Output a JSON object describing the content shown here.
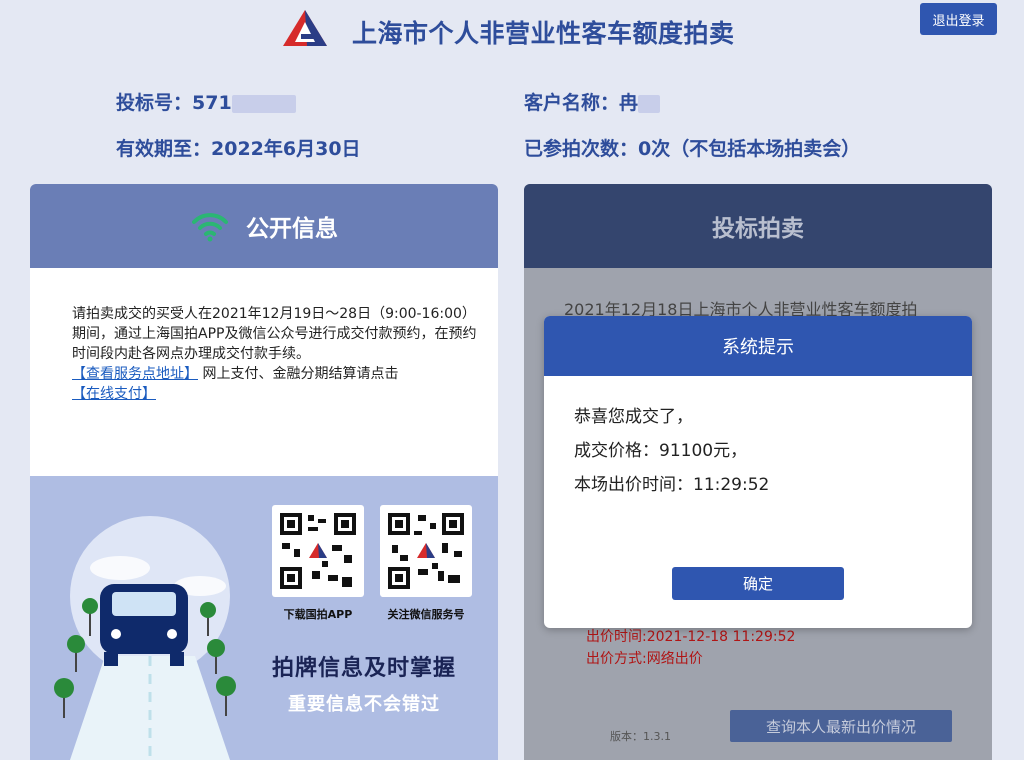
{
  "header": {
    "title": "上海市个人非营业性客车额度拍卖",
    "logout_label": "退出登录"
  },
  "info": {
    "bid_no_label": "投标号：",
    "bid_no_value": "571",
    "valid_until_label": "有效期至：",
    "valid_until_value": "2022年6月30日",
    "customer_label": "客户名称：",
    "customer_value": "冉",
    "participations_label": "已参拍次数：",
    "participations_value": "0次（不包括本场拍卖会）"
  },
  "left_panel": {
    "title": "公开信息",
    "icon": "wifi-icon",
    "notice_text_1": "请拍卖成交的买受人在2021年12月19日～28日（9:00-16:00）期间，通过上海国拍APP及微信公众号进行成交付款预约，在预约时间段内赴各网点办理成交付款手续。",
    "service_link": "【查看服务点地址】",
    "notice_text_2": " 网上支付、金融分期结算请点击",
    "pay_link": "【在线支付】",
    "qr_app_caption": "下载国拍APP",
    "qr_wechat_caption": "关注微信服务号",
    "promo_title": "拍牌信息及时掌握",
    "promo_subtitle": "重要信息不会错过"
  },
  "right_panel": {
    "title": "投标拍卖",
    "notice_line": "2021年12月18日上海市个人非营业性客车额度拍",
    "bid_time": "出价时间:2021-12-18 11:29:52",
    "bid_method": "出价方式:网络出价",
    "version": "版本：1.3.1",
    "query_button": "查询本人最新出价情况"
  },
  "dialog": {
    "title": "系统提示",
    "line1": "恭喜您成交了，",
    "line2": "成交价格：91100元，",
    "line3": "本场出价时间：11:29:52",
    "ok_button": "确定"
  },
  "colors": {
    "brand_blue": "#2f56b0",
    "title_blue": "#2e4d9b",
    "wifi_green": "#2bb673",
    "warning_red": "#b01515"
  }
}
